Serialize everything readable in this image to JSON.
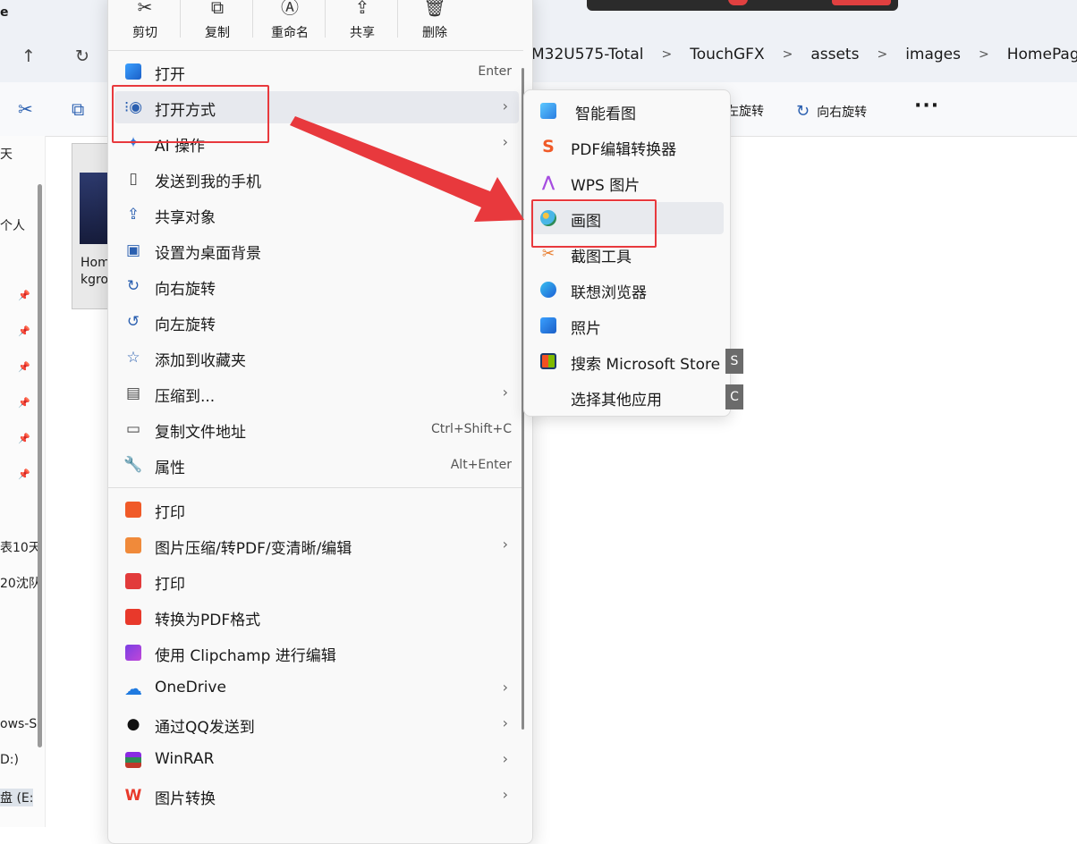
{
  "window": {
    "title_fragment": "e",
    "nav_up": "↑",
    "nav_refresh": "↻"
  },
  "breadcrumb": [
    "M32U575-Total",
    "TouchGFX",
    "assets",
    "images",
    "HomePage"
  ],
  "toolbar": {
    "rotate_left_partial": "左旋转",
    "rotate_right": "向右旋转",
    "more": "···"
  },
  "left_pane": {
    "items": [
      "天",
      "个人",
      "表10天",
      "20沈队",
      "ows-S",
      "D:)",
      "盘 (E:"
    ]
  },
  "thumbnail": {
    "name_line1": "Hom",
    "name_line2": "kgro"
  },
  "quick_actions": [
    {
      "label": "剪切",
      "icon": "scissors-icon"
    },
    {
      "label": "复制",
      "icon": "copy-icon"
    },
    {
      "label": "重命名",
      "icon": "rename-icon"
    },
    {
      "label": "共享",
      "icon": "share-icon"
    },
    {
      "label": "删除",
      "icon": "trash-icon"
    }
  ],
  "context_menu": {
    "items": [
      {
        "label": "打开",
        "shortcut": "Enter",
        "icon": "image-icon"
      },
      {
        "label": "打开方式",
        "submenu": true,
        "icon": "open-with-icon"
      },
      {
        "label": "AI 操作",
        "submenu": true,
        "icon": "ai-sparkle-icon"
      },
      {
        "label": "发送到我的手机",
        "icon": "phone-icon"
      },
      {
        "label": "共享对象",
        "icon": "share-icon"
      },
      {
        "label": "设置为桌面背景",
        "icon": "wallpaper-icon"
      },
      {
        "label": "向右旋转",
        "icon": "rotate-right-icon"
      },
      {
        "label": "向左旋转",
        "icon": "rotate-left-icon"
      },
      {
        "label": "添加到收藏夹",
        "icon": "star-icon"
      },
      {
        "label": "压缩到...",
        "submenu": true,
        "icon": "zip-icon"
      },
      {
        "label": "复制文件地址",
        "shortcut": "Ctrl+Shift+C",
        "icon": "path-icon"
      },
      {
        "label": "属性",
        "shortcut": "Alt+Enter",
        "icon": "wrench-icon"
      },
      {
        "label": "打印",
        "icon": "print-icon"
      },
      {
        "label": "图片压缩/转PDF/变清晰/编辑",
        "submenu": true,
        "icon": "image-edit-icon"
      },
      {
        "label": "打印",
        "icon": "print-red-icon"
      },
      {
        "label": "转换为PDF格式",
        "icon": "pdf-icon"
      },
      {
        "label": "使用 Clipchamp 进行编辑",
        "icon": "clipchamp-icon"
      },
      {
        "label": "OneDrive",
        "submenu": true,
        "icon": "cloud-icon"
      },
      {
        "label": "通过QQ发送到",
        "submenu": true,
        "icon": "qq-icon"
      },
      {
        "label": "WinRAR",
        "submenu": true,
        "icon": "winrar-icon"
      },
      {
        "label": "图片转换",
        "submenu": true,
        "icon": "wps-icon"
      }
    ],
    "submenu_arrow": "›"
  },
  "open_with_submenu": {
    "items": [
      {
        "label": "智能看图",
        "icon": "image-viewer-icon"
      },
      {
        "label": "PDF编辑转换器",
        "icon": "pdf-editor-icon"
      },
      {
        "label": "WPS 图片",
        "icon": "wps-image-icon"
      },
      {
        "label": "画图",
        "icon": "paint-icon"
      },
      {
        "label": "截图工具",
        "icon": "snipping-tool-icon"
      },
      {
        "label": "联想浏览器",
        "icon": "browser-icon"
      },
      {
        "label": "照片",
        "icon": "photos-icon"
      },
      {
        "label": "搜索 Microsoft Store",
        "icon": "store-icon",
        "keytip": "S"
      },
      {
        "label": "选择其他应用",
        "keytip": "C"
      }
    ]
  },
  "colors": {
    "highlight_red": "#e8393d",
    "arrow_red": "#e8393d",
    "hover_bg": "#e7e9ee"
  }
}
